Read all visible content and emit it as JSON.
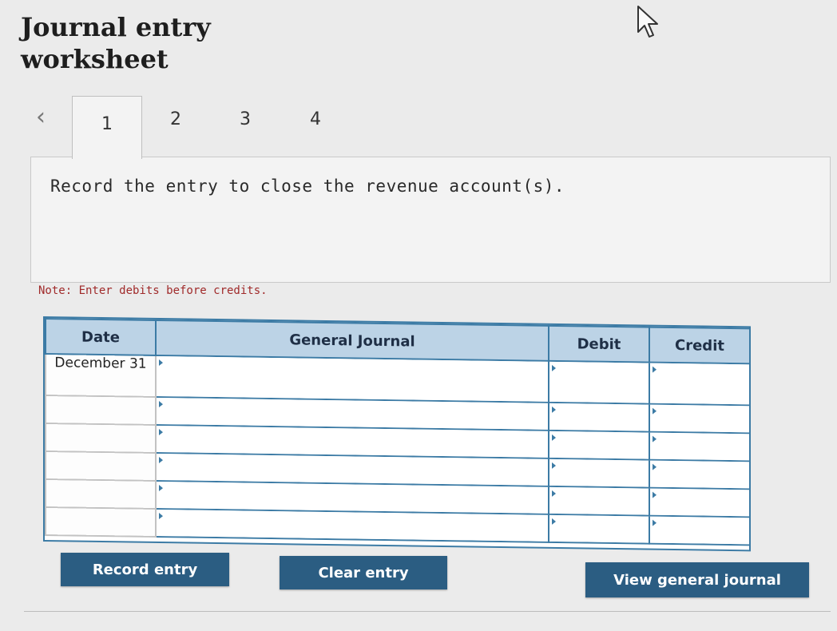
{
  "header": {
    "title": "Journal entry worksheet"
  },
  "tabs": {
    "prev_icon": "chevron-left-icon",
    "items": [
      "1",
      "2",
      "3",
      "4"
    ],
    "active": "1"
  },
  "instruction": "Record the entry to close the revenue account(s).",
  "note": "Note: Enter debits before credits.",
  "journal": {
    "columns": [
      "Date",
      "General Journal",
      "Debit",
      "Credit"
    ],
    "rows": [
      {
        "date": "December 31",
        "account": "",
        "debit": "",
        "credit": ""
      },
      {
        "date": "",
        "account": "",
        "debit": "",
        "credit": ""
      },
      {
        "date": "",
        "account": "",
        "debit": "",
        "credit": ""
      },
      {
        "date": "",
        "account": "",
        "debit": "",
        "credit": ""
      },
      {
        "date": "",
        "account": "",
        "debit": "",
        "credit": ""
      },
      {
        "date": "",
        "account": "",
        "debit": "",
        "credit": ""
      }
    ]
  },
  "buttons": {
    "record": "Record entry",
    "clear": "Clear entry",
    "view": "View general journal"
  },
  "colors": {
    "button": "#2b5d82",
    "grid": "#3c7ba5",
    "header": "#bcd3e6",
    "note": "#a02a2a"
  }
}
